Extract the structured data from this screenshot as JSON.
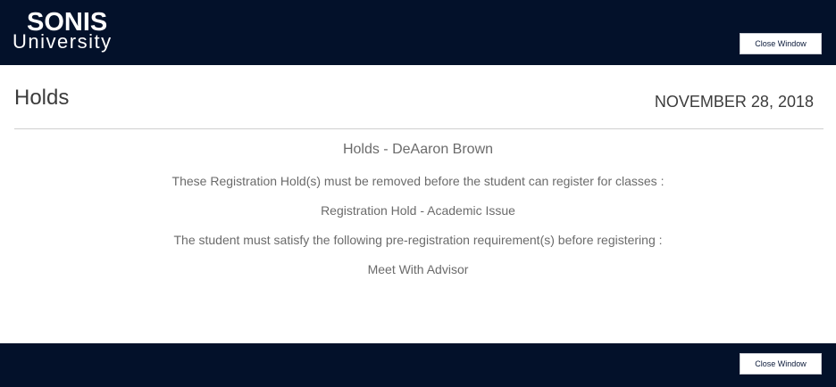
{
  "header": {
    "logo_line1": "SONIS",
    "logo_line2": "University",
    "close_label": "Close Window"
  },
  "page": {
    "title": "Holds",
    "date": "NOVEMBER 28, 2018"
  },
  "content": {
    "heading": "Holds - DeAaron Brown",
    "registration_holds_intro": "These Registration Hold(s) must be removed before the student can register for classes :",
    "registration_hold": "Registration Hold - Academic Issue",
    "prereg_intro": "The student must satisfy the following pre-registration requirement(s) before registering :",
    "prereg_requirement": "Meet With Advisor"
  },
  "footer": {
    "close_label": "Close Window"
  },
  "colors": {
    "brand_navy": "#03112a",
    "text_dark": "#3c3c3c",
    "text_muted": "#6b6b6b"
  }
}
